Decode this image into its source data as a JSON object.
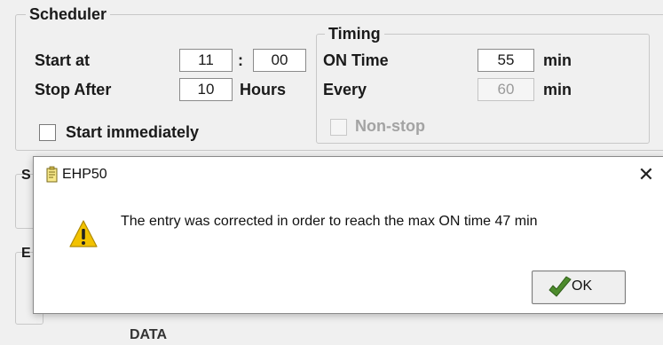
{
  "scheduler": {
    "legend": "Scheduler",
    "start_at_label": "Start at",
    "start_hour": "11",
    "time_sep": ":",
    "start_min": "00",
    "stop_after_label": "Stop After",
    "stop_after_value": "10",
    "hours_label": "Hours",
    "start_immediately_label": "Start immediately"
  },
  "timing": {
    "legend": "Timing",
    "on_time_label": "ON Time",
    "on_time_value": "55",
    "on_time_unit": "min",
    "every_label": "Every",
    "every_value": "60",
    "every_unit": "min",
    "non_stop_label": "Non-stop"
  },
  "background": {
    "partial_labels": [
      "S",
      "E"
    ],
    "bottom_partial": "DATA"
  },
  "dialog": {
    "title": "EHP50",
    "close_glyph": "✕",
    "message": "The entry was corrected in order to reach the max ON time 47 min",
    "ok_label": "OK",
    "icons": {
      "title": "notepad-icon",
      "message": "warning-icon",
      "ok": "checkmark-icon"
    }
  },
  "colors": {
    "warning": "#f2c200",
    "ok_check": "#4d8b2c"
  }
}
